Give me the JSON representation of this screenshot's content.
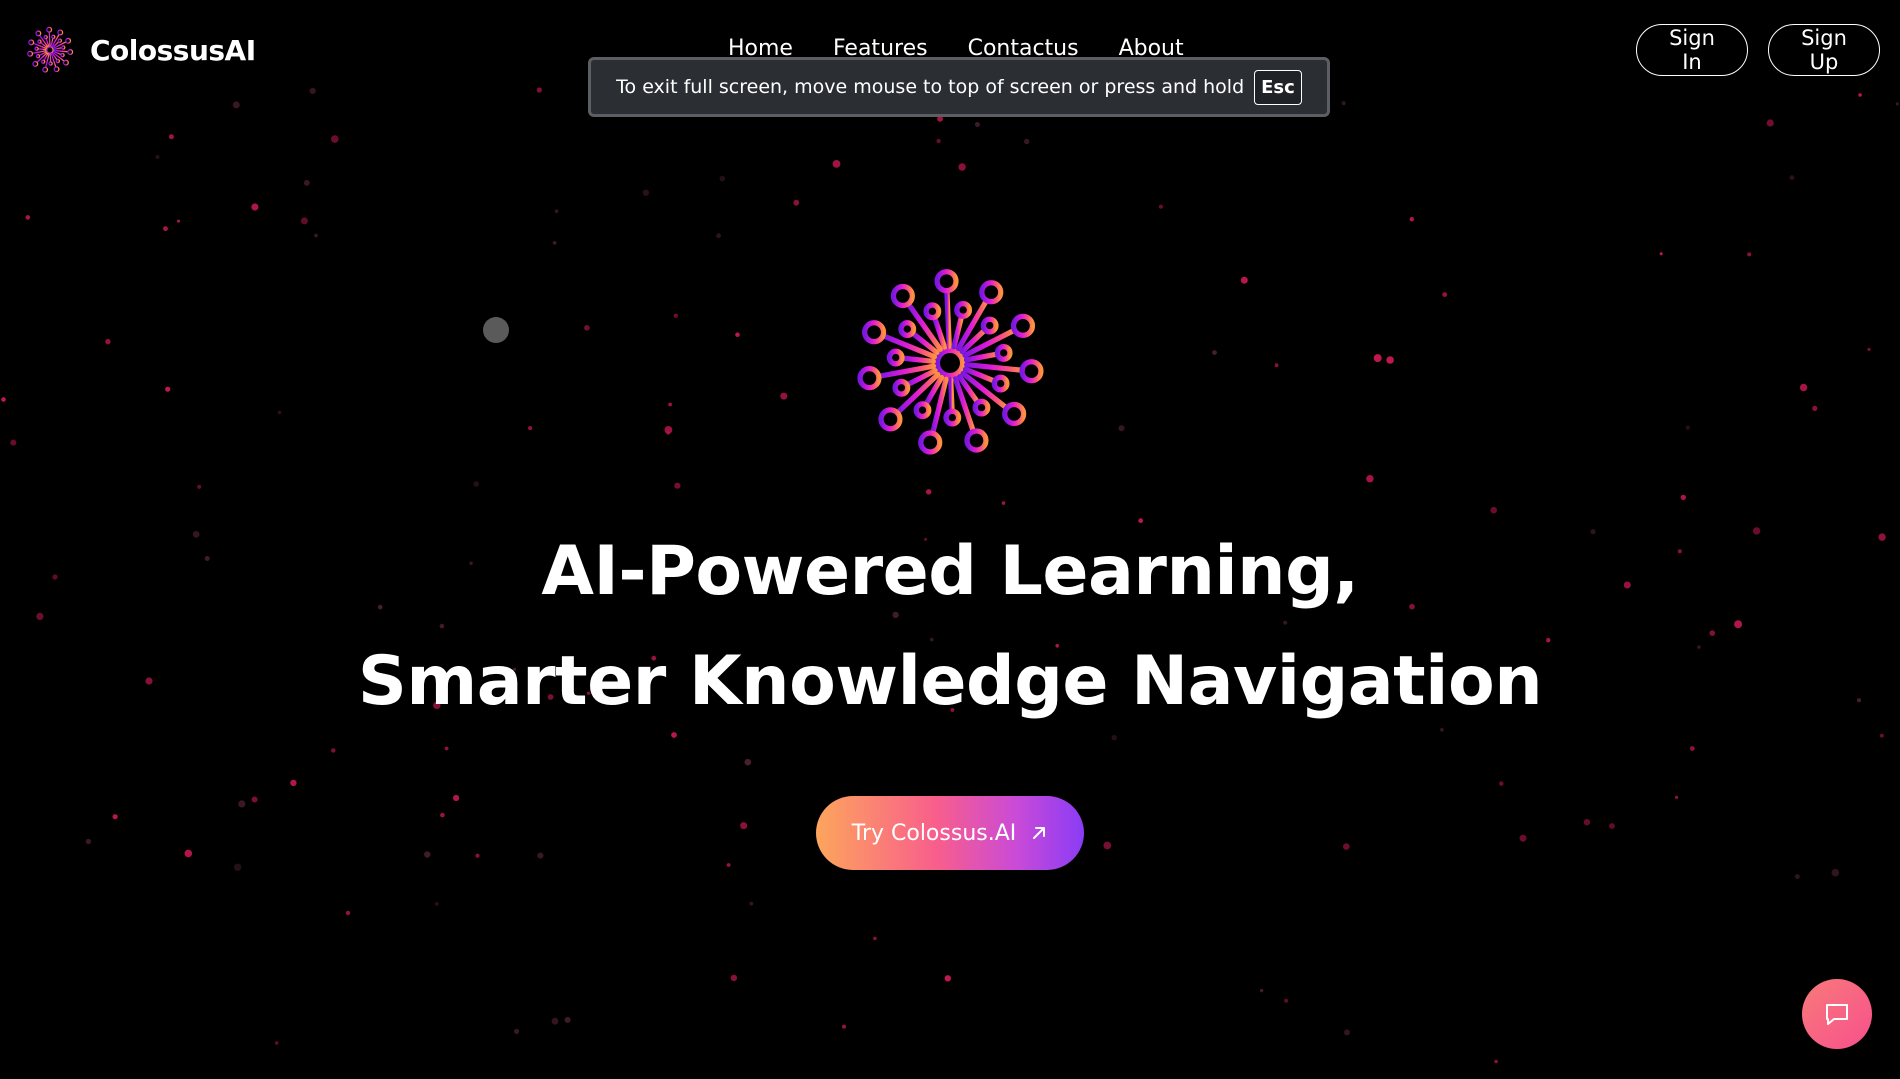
{
  "brand": {
    "name": "ColossusAI",
    "logo_icon": "colossus-burst-logo-icon"
  },
  "nav": {
    "items": [
      {
        "label": "Home"
      },
      {
        "label": "Features"
      },
      {
        "label": "Contactus"
      },
      {
        "label": "About"
      }
    ]
  },
  "auth": {
    "sign_in_label": "Sign In",
    "sign_up_label": "Sign Up"
  },
  "fullscreen_notice": {
    "text": "To exit full screen, move mouse to top of screen or press and hold",
    "key": "Esc"
  },
  "hero": {
    "logo_icon": "colossus-burst-logo-icon",
    "title_line1": "AI-Powered Learning,",
    "title_line2": "Smarter Knowledge Navigation",
    "cta_label": "Try Colossus.AI",
    "cta_icon": "arrow-up-right-icon"
  },
  "chat": {
    "icon": "chat-bubble-icon"
  },
  "colors": {
    "background": "#000000",
    "text": "#ffffff",
    "particle": "#c2184f",
    "gradient_orange": "#fda55c",
    "gradient_pink": "#f85e8c",
    "gradient_purple": "#8a3cf5"
  }
}
